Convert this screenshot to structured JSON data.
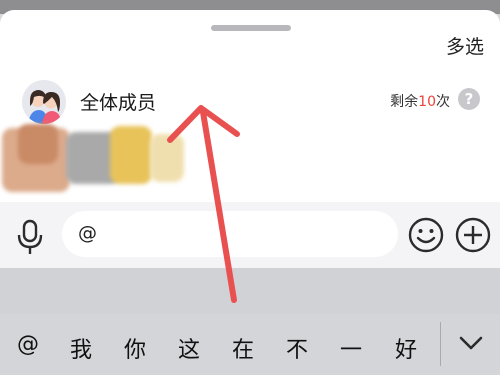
{
  "header": {
    "multi_select_label": "多选"
  },
  "member_row": {
    "avatar_icon": "group-avatar-icon",
    "name": "全体成员",
    "remaining_prefix": "剩余",
    "remaining_count": "10",
    "remaining_suffix": "次",
    "help_icon": "question-mark-icon",
    "help_symbol": "?"
  },
  "input_bar": {
    "voice_icon": "microphone-icon",
    "input_value": "@",
    "emoji_icon": "smiley-icon",
    "more_icon": "plus-circle-icon"
  },
  "keyboard": {
    "suggestions": [
      "@",
      "我",
      "你",
      "这",
      "在",
      "不",
      "一",
      "好"
    ],
    "collapse_icon": "chevron-down-icon"
  },
  "annotation": {
    "arrow_color": "#e8514f"
  },
  "colors": {
    "remaining_count": "#e8433a"
  }
}
